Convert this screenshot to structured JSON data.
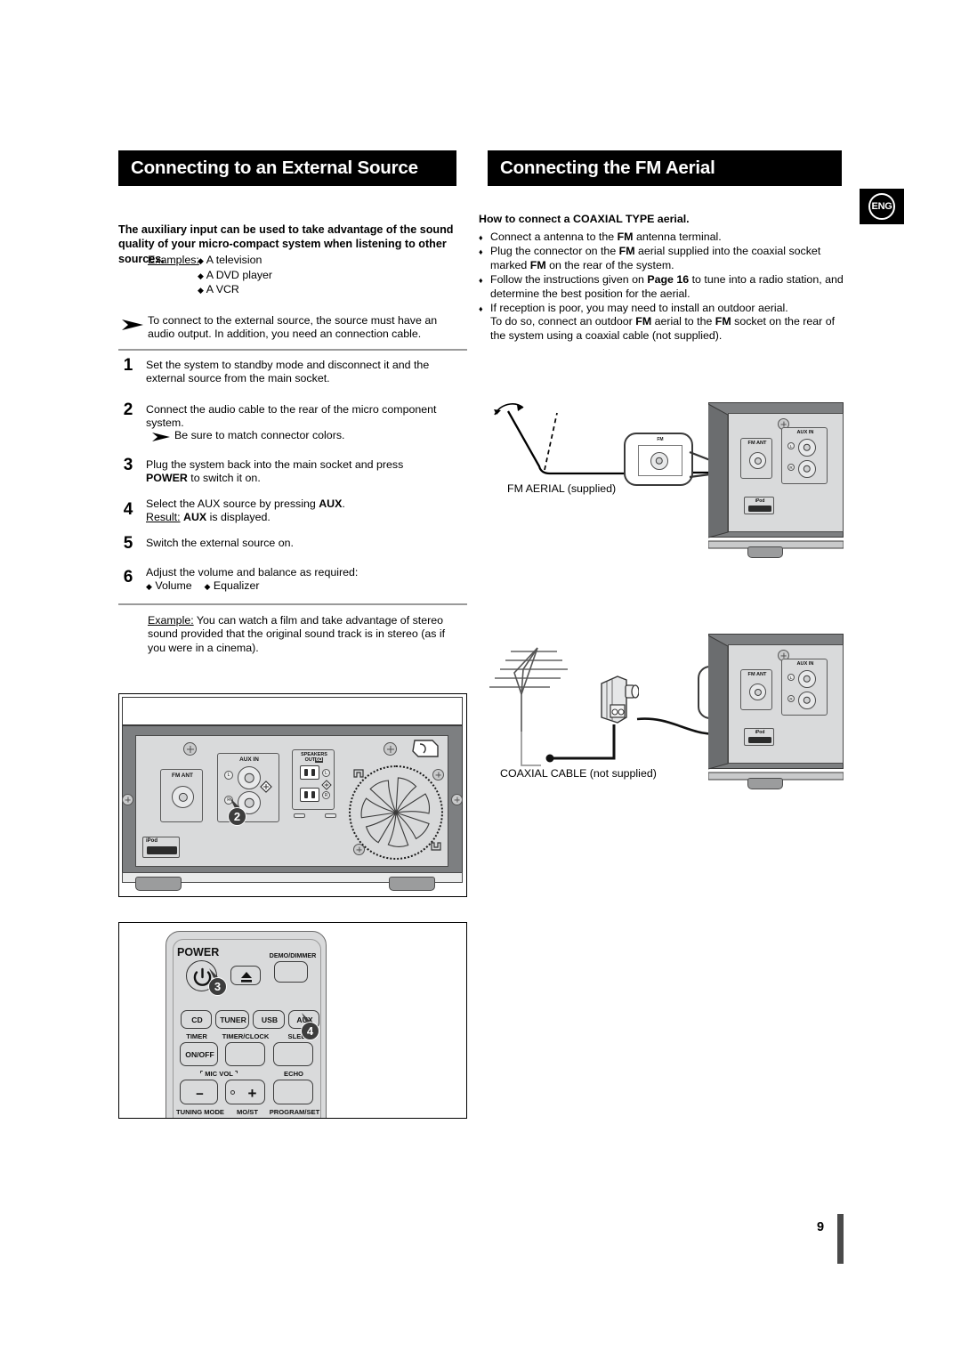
{
  "document": {
    "page_number": "9",
    "language_badge": "ENG"
  },
  "left_column": {
    "header": "Connecting to an External Source",
    "intro": "The auxiliary input can be used to take advantage of the sound quality of your micro-compact system when listening to other sources.",
    "examples_label": "Examples:",
    "examples": [
      "A television",
      "A DVD player",
      "A VCR"
    ],
    "note_connect": "To connect to the external source, the source must have an audio output. In addition, you need an connection cable.",
    "steps": [
      {
        "num": "1",
        "text": "Set the system to standby mode and disconnect it and the external source from the main socket."
      },
      {
        "num": "2",
        "text": "Connect the audio cable to the rear of the micro component system."
      },
      {
        "num": "3",
        "text": "Plug the system back into the main socket and press POWER to switch it on.",
        "bold_word": "POWER"
      },
      {
        "num": "4",
        "text": "Select the AUX source by pressing AUX.",
        "result_label": "Result:",
        "result_text": "AUX is displayed."
      },
      {
        "num": "5",
        "text": "Switch the external source on."
      },
      {
        "num": "6",
        "text": "Adjust the volume and balance as required:",
        "options": [
          "Volume",
          "Equalizer"
        ]
      }
    ],
    "note_match_colors": "Be sure to match connector colors.",
    "example_label": "Example:",
    "example_text": "You can watch a film and take advantage of stereo sound provided that the original sound track is in stereo (as if you were in a cinema)."
  },
  "right_column": {
    "header": "Connecting the FM Aerial",
    "subheading": "How to connect a COAXIAL TYPE aerial.",
    "bullets": [
      "Connect a antenna to the FM antenna terminal.",
      "Plug the connector on the FM aerial supplied into the coaxial socket marked FM on the rear of the system.",
      "Follow the instructions given on Page 16 to tune into a radio station, and determine the best position for the aerial.",
      "If reception is poor, you may need to install an outdoor aerial. To do so, connect an outdoor FM aerial to the FM socket on the rear of the system using a coaxial cable (not supplied)."
    ],
    "figure_labels": {
      "fm_aerial": "FM AERIAL (supplied)",
      "coaxial_cable": "COAXIAL CABLE (not supplied)"
    }
  },
  "rear_panel": {
    "fm_ant_label": "FM ANT",
    "aux_in_label": "AUX IN",
    "speakers_label_line1": "SPEAKERS",
    "speakers_label_line2": "OUT",
    "speakers_impedance": "6Ω",
    "ipod_label": "iPod",
    "channel_left": "L",
    "channel_right": "R",
    "callout_number": "2",
    "zoom_label_fm": "FM"
  },
  "remote": {
    "power_label": "POWER",
    "demo_dimmer_label": "DEMO/DIMMER",
    "source_buttons": [
      "CD",
      "TUNER",
      "USB",
      "AUX"
    ],
    "row_labels_timer": [
      "TIMER",
      "TIMER/CLOCK",
      "SLEEP"
    ],
    "on_off_label": "ON/OFF",
    "mic_vol_label": "MIC VOL",
    "echo_label": "ECHO",
    "minus_label": "−",
    "plus_label": "+",
    "bottom_labels": [
      "TUNING MODE",
      "MO/ST",
      "PROGRAM/SET"
    ],
    "callout_power": "3",
    "callout_aux": "4"
  },
  "colors": {
    "header_bg": "#000000",
    "header_fg": "#ffffff",
    "rule": "#9a9a9a",
    "panel_body": "#7d7f81",
    "panel_plate": "#d9dadb",
    "bubble": "#3d3d3d"
  }
}
